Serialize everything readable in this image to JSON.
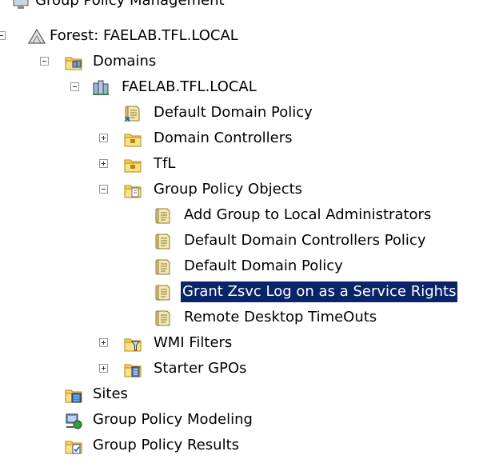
{
  "tree": {
    "root": {
      "label": "Group Policy Management",
      "icon": "gpm-console-icon"
    },
    "forest": {
      "label": "Forest: FAELAB.TFL.LOCAL",
      "icon": "forest-icon",
      "expanded": true
    },
    "domains": {
      "label": "Domains",
      "icon": "domains-folder-icon",
      "expanded": true
    },
    "domain": {
      "label": "FAELAB.TFL.LOCAL",
      "icon": "domain-icon",
      "expanded": true
    },
    "default_domain_policy_link": {
      "label": "Default Domain Policy",
      "icon": "gpo-link-icon"
    },
    "domain_controllers": {
      "label": "Domain Controllers",
      "icon": "ou-folder-icon",
      "expanded": false
    },
    "tfl": {
      "label": "TfL",
      "icon": "ou-folder-icon",
      "expanded": false
    },
    "gpo_folder": {
      "label": "Group Policy Objects",
      "icon": "gpo-folder-icon",
      "expanded": true
    },
    "gpos": [
      {
        "label": "Add Group to Local Administrators",
        "icon": "gpo-icon",
        "selected": false
      },
      {
        "label": "Default Domain Controllers Policy",
        "icon": "gpo-icon",
        "selected": false
      },
      {
        "label": "Default Domain Policy",
        "icon": "gpo-icon",
        "selected": false
      },
      {
        "label": "Grant Zsvc Log on as a Service Rights",
        "icon": "gpo-icon",
        "selected": true
      },
      {
        "label": "Remote Desktop TimeOuts",
        "icon": "gpo-icon",
        "selected": false
      }
    ],
    "wmi_filters": {
      "label": "WMI Filters",
      "icon": "wmi-filters-icon",
      "expanded": false
    },
    "starter_gpos": {
      "label": "Starter GPOs",
      "icon": "starter-gpos-icon",
      "expanded": false
    },
    "sites": {
      "label": "Sites",
      "icon": "sites-icon"
    },
    "modeling": {
      "label": "Group Policy Modeling",
      "icon": "gp-modeling-icon"
    },
    "results": {
      "label": "Group Policy Results",
      "icon": "gp-results-icon"
    }
  },
  "colors": {
    "selection_bg": "#0a246a",
    "selection_text": "#ffffff",
    "folder": "#f2c94c"
  }
}
